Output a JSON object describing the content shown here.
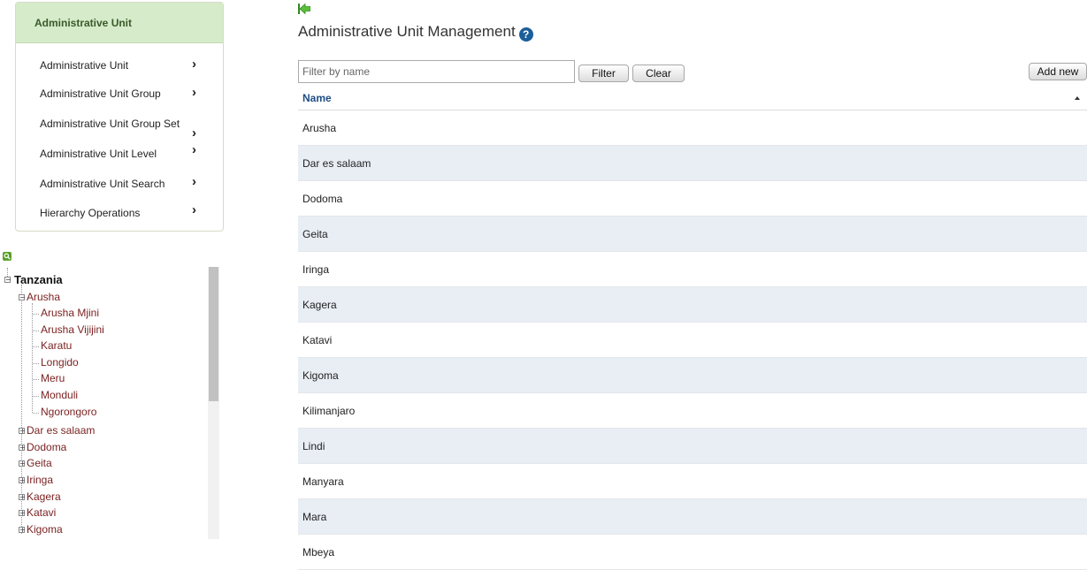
{
  "menu": {
    "header": "Administrative Unit",
    "items": [
      {
        "label": "Administrative Unit"
      },
      {
        "label": "Administrative Unit Group"
      },
      {
        "label": "Administrative Unit Group Set"
      },
      {
        "label": "Administrative Unit Level"
      },
      {
        "label": "Administrative Unit Search"
      },
      {
        "label": "Hierarchy Operations"
      }
    ],
    "chevron": "›"
  },
  "tree": {
    "search_icon": "search-icon",
    "root": "Tanzania",
    "expanded": "Arusha",
    "children": [
      "Arusha Mjini",
      "Arusha Vijijini",
      "Karatu",
      "Longido",
      "Meru",
      "Monduli",
      "Ngorongoro"
    ],
    "collapsed": [
      "Dar es salaam",
      "Dodoma",
      "Geita",
      "Iringa",
      "Kagera",
      "Katavi",
      "Kigoma"
    ]
  },
  "main": {
    "title": "Administrative Unit Management",
    "help_icon": "?",
    "filter_placeholder": "Filter by name",
    "filter_button": "Filter",
    "clear_button": "Clear",
    "add_button": "Add new",
    "column_header": "Name",
    "rows": [
      "Arusha",
      "Dar es salaam",
      "Dodoma",
      "Geita",
      "Iringa",
      "Kagera",
      "Katavi",
      "Kigoma",
      "Kilimanjaro",
      "Lindi",
      "Manyara",
      "Mara",
      "Mbeya"
    ]
  }
}
